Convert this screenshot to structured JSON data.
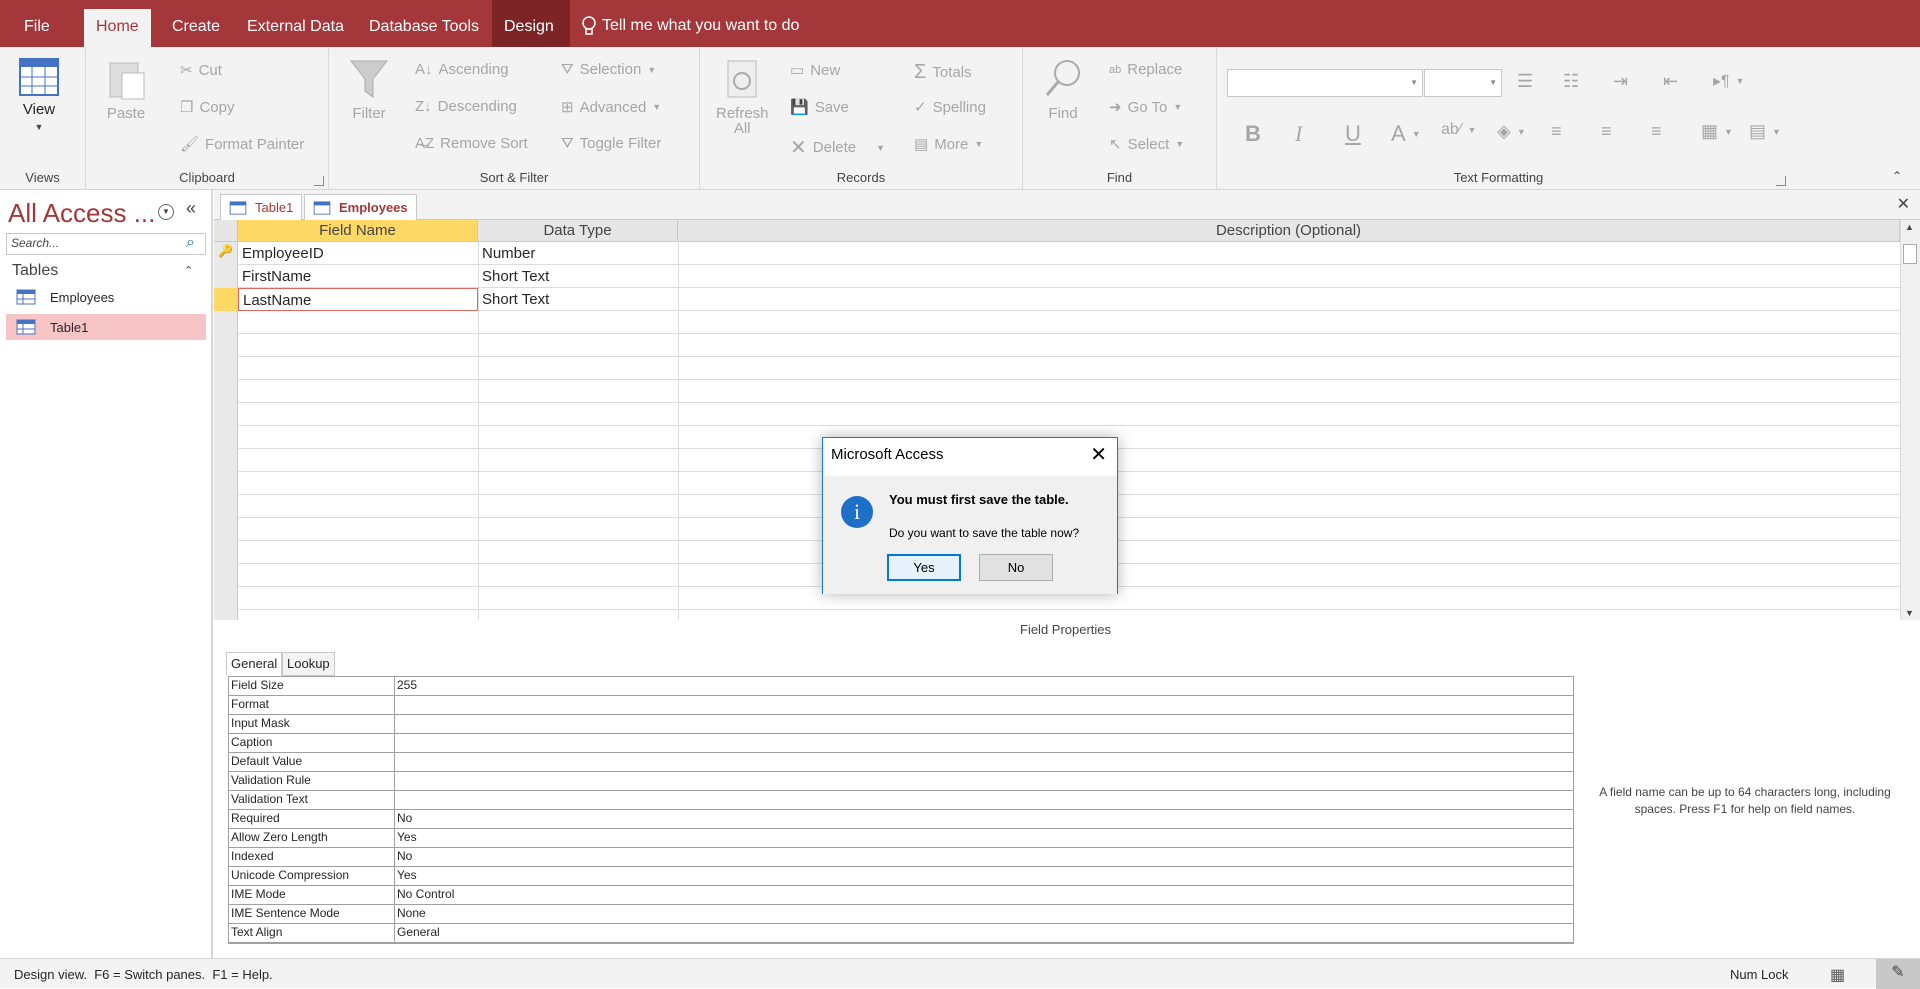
{
  "ribbon_tabs": [
    "File",
    "Home",
    "Create",
    "External Data",
    "Database Tools",
    "Design"
  ],
  "tell_me": "Tell me what you want to do",
  "ribbon": {
    "views": {
      "view": "View",
      "label": "Views"
    },
    "clipboard": {
      "paste": "Paste",
      "cut": "Cut",
      "copy": "Copy",
      "format_painter": "Format Painter",
      "label": "Clipboard"
    },
    "sort_filter": {
      "filter": "Filter",
      "ascending": "Ascending",
      "descending": "Descending",
      "remove_sort": "Remove Sort",
      "selection": "Selection",
      "advanced": "Advanced",
      "toggle_filter": "Toggle Filter",
      "label": "Sort & Filter"
    },
    "records": {
      "refresh": "Refresh",
      "refresh_all": "All",
      "new": "New",
      "save": "Save",
      "delete": "Delete",
      "totals": "Totals",
      "spelling": "Spelling",
      "more": "More",
      "label": "Records"
    },
    "find": {
      "find": "Find",
      "replace": "Replace",
      "go_to": "Go To",
      "select": "Select",
      "label": "Find"
    },
    "text_formatting": {
      "label": "Text Formatting",
      "bold": "B",
      "italic": "I",
      "underline": "U",
      "font_color": "A"
    }
  },
  "nav": {
    "title": "All Access ...",
    "search_placeholder": "Search...",
    "group": "Tables",
    "items": [
      {
        "label": "Employees"
      },
      {
        "label": "Table1"
      }
    ]
  },
  "doc_tabs": [
    "Table1",
    "Employees"
  ],
  "grid": {
    "headers": [
      "Field Name",
      "Data Type",
      "Description (Optional)"
    ],
    "rows": [
      {
        "field": "EmployeeID",
        "type": "Number",
        "description": ""
      },
      {
        "field": "FirstName",
        "type": "Short Text",
        "description": ""
      },
      {
        "field": "LastName",
        "type": "Short Text",
        "description": ""
      }
    ]
  },
  "field_properties_label": "Field Properties",
  "prop_tabs": [
    "General",
    "Lookup"
  ],
  "properties": [
    {
      "name": "Field Size",
      "value": "255"
    },
    {
      "name": "Format",
      "value": ""
    },
    {
      "name": "Input Mask",
      "value": ""
    },
    {
      "name": "Caption",
      "value": ""
    },
    {
      "name": "Default Value",
      "value": ""
    },
    {
      "name": "Validation Rule",
      "value": ""
    },
    {
      "name": "Validation Text",
      "value": ""
    },
    {
      "name": "Required",
      "value": "No"
    },
    {
      "name": "Allow Zero Length",
      "value": "Yes"
    },
    {
      "name": "Indexed",
      "value": "No"
    },
    {
      "name": "Unicode Compression",
      "value": "Yes"
    },
    {
      "name": "IME Mode",
      "value": "No Control"
    },
    {
      "name": "IME Sentence Mode",
      "value": "None"
    },
    {
      "name": "Text Align",
      "value": "General"
    }
  ],
  "help_text": "A field name can be up to 64 characters long, including spaces. Press F1 for help on field names.",
  "status": {
    "left": "Design view.  F6 = Switch panes.  F1 = Help.",
    "num_lock": "Num Lock"
  },
  "dialog": {
    "title": "Microsoft Access",
    "message": "You must first save the table.",
    "question": "Do you want to save the table now?",
    "yes": "Yes",
    "no": "No",
    "info_glyph": "i"
  },
  "colors": {
    "accent": "#a4373a",
    "selected_nav": "#f8c5c6",
    "header_highlight": "#ffd966",
    "dialog_border": "#1979ca"
  }
}
